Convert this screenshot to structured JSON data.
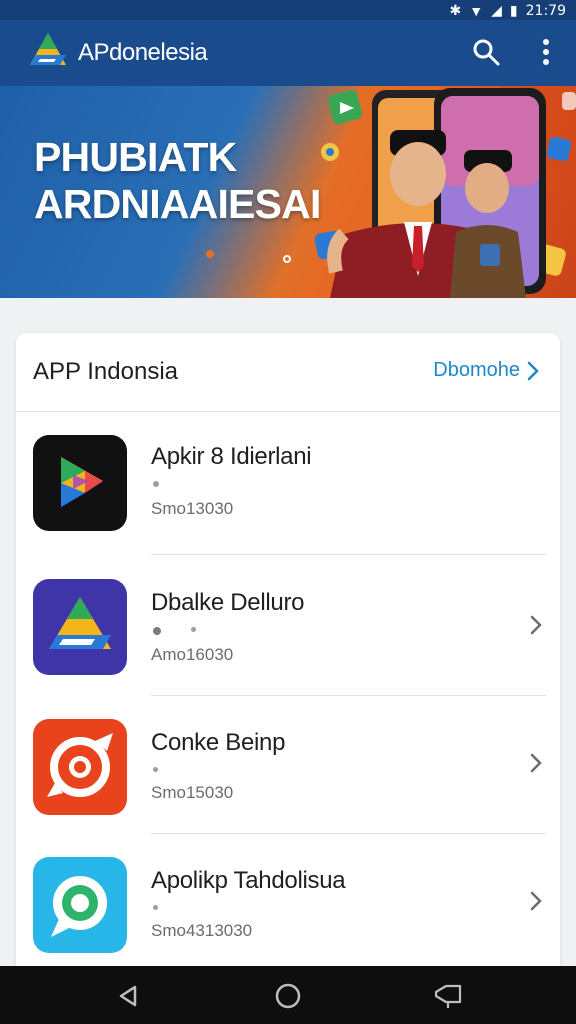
{
  "status_bar": {
    "time": "21:79"
  },
  "app_bar": {
    "title": "APdonelesia",
    "search_icon": "search-icon",
    "menu_icon": "more-vert-icon"
  },
  "banner": {
    "line1": "PHUBIATK",
    "line2": "ARDNIAAIESAI",
    "colors": {
      "blue": "#1f5fa8",
      "orange": "#e0702a"
    }
  },
  "section": {
    "title": "APP Indonsia",
    "link_label": "Dbomohe"
  },
  "apps": [
    {
      "name": "Apkir 8 Idierlani",
      "meta": "Smo13030",
      "icon": "colorful-play-icon",
      "has_chevron": false
    },
    {
      "name": "Dbalke Delluro",
      "meta": "Amo16030",
      "icon": "drive-triangle-icon",
      "has_chevron": true
    },
    {
      "name": "Conke Beinp",
      "meta": "Smo15030",
      "icon": "target-arrow-icon",
      "has_chevron": true
    },
    {
      "name": "Apolikp Tahdolisua",
      "meta": "Smo4313030",
      "icon": "chat-bubble-icon",
      "has_chevron": true
    }
  ],
  "nav": {
    "back": "back-icon",
    "home": "home-icon",
    "recents": "recents-icon"
  }
}
